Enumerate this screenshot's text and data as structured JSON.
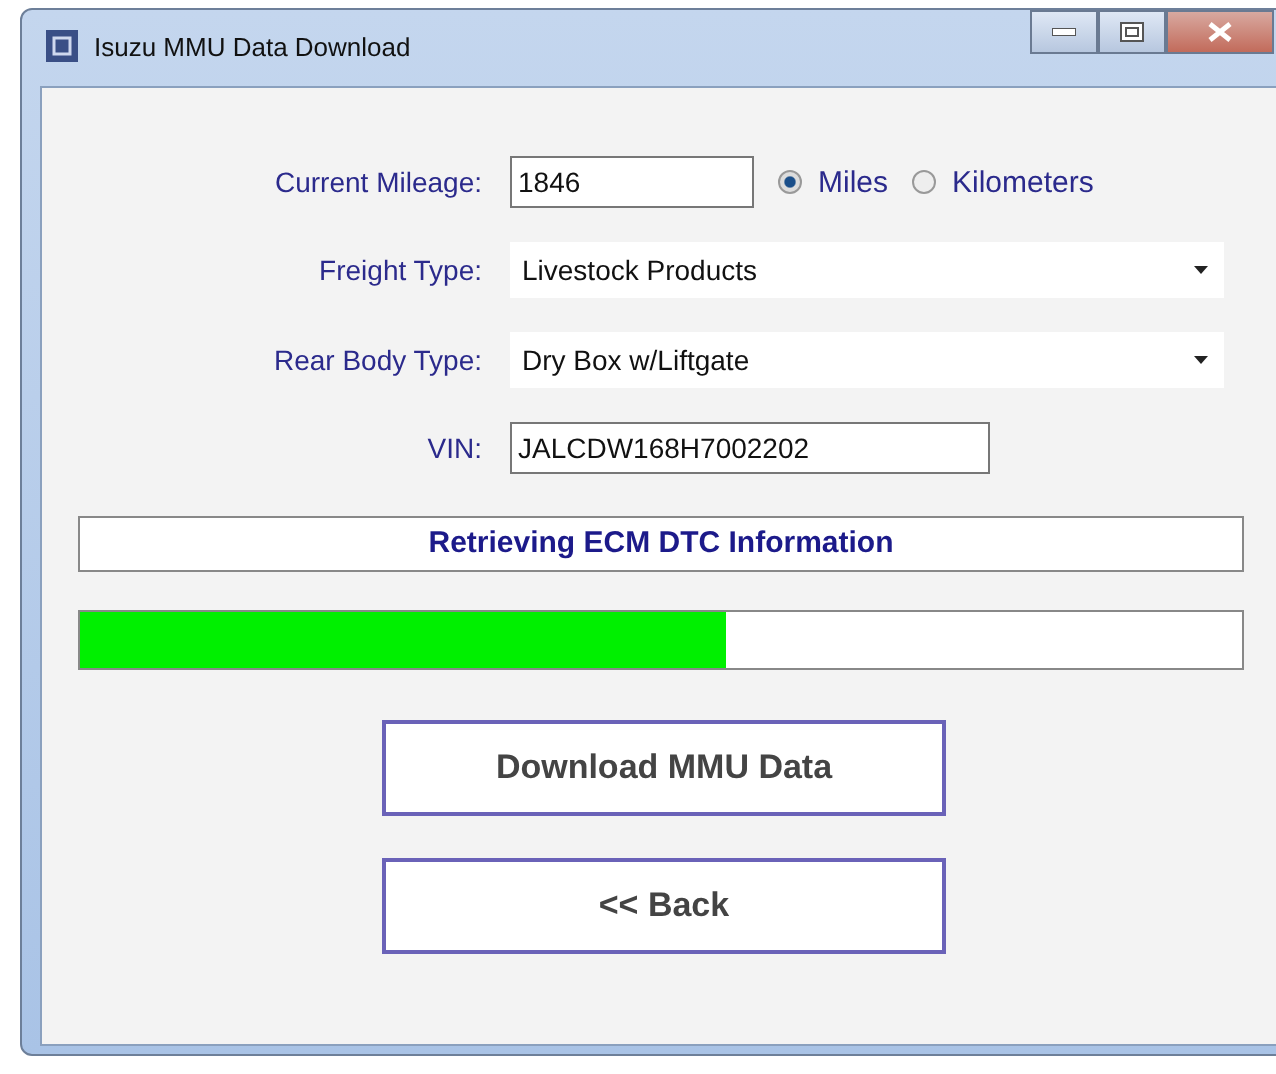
{
  "window": {
    "title": "Isuzu MMU Data Download"
  },
  "mileage": {
    "label": "Current Mileage:",
    "value": "1846",
    "units": [
      {
        "label": "Miles",
        "selected": true
      },
      {
        "label": "Kilometers",
        "selected": false
      }
    ]
  },
  "dropdowns": [
    {
      "label": "Freight Type:",
      "value": "Livestock Products"
    },
    {
      "label": "Rear Body Type:",
      "value": "Dry Box w/Liftgate"
    }
  ],
  "vin": {
    "label": "VIN:",
    "value": "JALCDW168H7002202"
  },
  "status": "Retrieving ECM DTC Information",
  "progress": {
    "level": 0.556
  },
  "buttons": [
    "Download MMU Data",
    "<< Back"
  ]
}
